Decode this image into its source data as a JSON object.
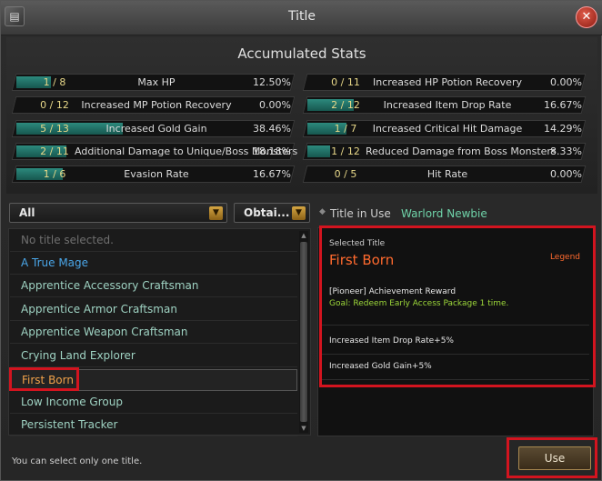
{
  "window": {
    "title": "Title"
  },
  "stats": {
    "heading": "Accumulated Stats",
    "items": [
      {
        "count": "1 / 8",
        "label": "Max HP",
        "value": "12.50%",
        "progress": 0.125
      },
      {
        "count": "0 / 11",
        "label": "Increased HP Potion Recovery",
        "value": "0.00%",
        "progress": 0
      },
      {
        "count": "0 / 12",
        "label": "Increased MP Potion Recovery",
        "value": "0.00%",
        "progress": 0
      },
      {
        "count": "2 / 12",
        "label": "Increased Item Drop Rate",
        "value": "16.67%",
        "progress": 0.1667
      },
      {
        "count": "5 / 13",
        "label": "Increased Gold Gain",
        "value": "38.46%",
        "progress": 0.3846
      },
      {
        "count": "1 / 7",
        "label": "Increased Critical Hit Damage",
        "value": "14.29%",
        "progress": 0.1429
      },
      {
        "count": "2 / 11",
        "label": "Additional Damage to Unique/Boss Monsters",
        "value": "18.18%",
        "progress": 0.1818
      },
      {
        "count": "1 / 12",
        "label": "Reduced Damage from Boss Monsters",
        "value": "8.33%",
        "progress": 0.0833
      },
      {
        "count": "1 / 6",
        "label": "Evasion Rate",
        "value": "16.67%",
        "progress": 0.1667
      },
      {
        "count": "0 / 5",
        "label": "Hit Rate",
        "value": "0.00%",
        "progress": 0
      }
    ]
  },
  "filters": {
    "category": "All",
    "status": "Obtai..."
  },
  "title_list": [
    {
      "label": "No title selected."
    },
    {
      "label": "A True Mage"
    },
    {
      "label": "Apprentice Accessory Craftsman"
    },
    {
      "label": "Apprentice Armor Craftsman"
    },
    {
      "label": "Apprentice Weapon Craftsman"
    },
    {
      "label": "Crying Land Explorer"
    },
    {
      "label": "First Born"
    },
    {
      "label": "Low Income Group"
    },
    {
      "label": "Persistent Tracker"
    }
  ],
  "in_use": {
    "label": "Title in Use",
    "value": "Warlord Newbie"
  },
  "detail": {
    "selected_label": "Selected Title",
    "name": "First Born",
    "rarity": "Legend",
    "reward": "[Pioneer] Achievement Reward",
    "goal": "Goal: Redeem Early Access Package 1 time.",
    "effects": [
      "Increased Item Drop Rate+5%",
      "Increased Gold Gain+5%"
    ]
  },
  "footer": {
    "note": "You can select only one title.",
    "use_label": "Use"
  },
  "colors": {
    "highlight": "#d3141f",
    "legend": "#ff6a2e",
    "goal": "#9dd83a",
    "progress": "#2c8a7d"
  }
}
